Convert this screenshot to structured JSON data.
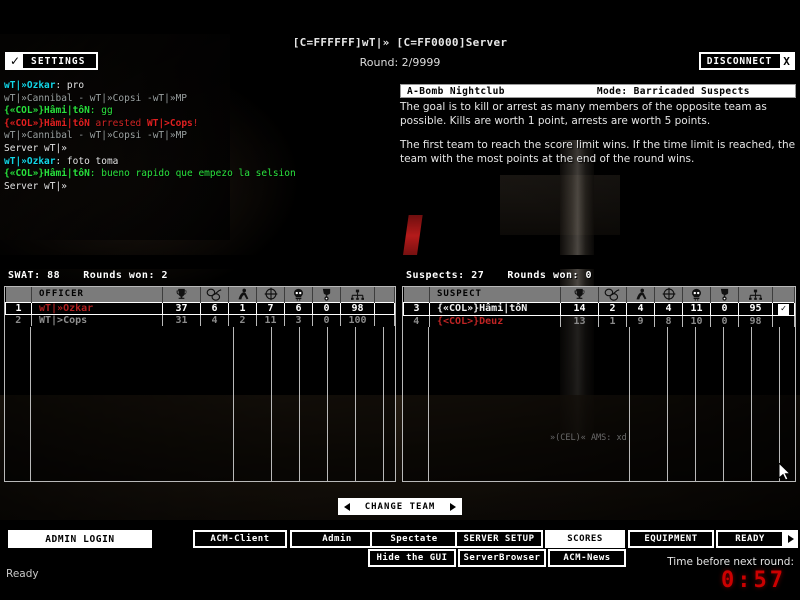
{
  "header": {
    "server_title": "[C=FFFFFF]wT|» [C=FF0000]Server",
    "round_line": "Round: 2/9999",
    "settings_label": "SETTINGS",
    "settings_check": "✓",
    "disconnect_label": "DISCONNECT",
    "disconnect_x": "X"
  },
  "chat": {
    "lines": [
      {
        "segments": [
          {
            "text": "wT|»Ozkar",
            "style": "c-name-c"
          },
          {
            "text": ": pro",
            "style": "c-white"
          }
        ]
      },
      {
        "segments": [
          {
            "text": " wT|»Cannibal - wT|»Copsi -wT|»MP",
            "style": "c-dim"
          }
        ]
      },
      {
        "segments": [
          {
            "text": "{«COL»}Hâmi|tôN",
            "style": "c-green"
          },
          {
            "text": ": gg",
            "style": "c-greenmsg"
          }
        ]
      },
      {
        "segments": [
          {
            "text": "{«COL»}Hâmi|tôN",
            "style": "c-red"
          },
          {
            "text": " arrested ",
            "style": "c-redmsg"
          },
          {
            "text": "WT|>Cops",
            "style": "c-red"
          },
          {
            "text": "!",
            "style": "c-redmsg"
          }
        ]
      },
      {
        "segments": [
          {
            "text": " wT|»Cannibal - wT|»Copsi -wT|»MP",
            "style": "c-dim"
          }
        ]
      },
      {
        "segments": [
          {
            "text": "Server wT|»",
            "style": "c-white"
          }
        ]
      },
      {
        "segments": [
          {
            "text": "wT|»Ozkar",
            "style": "c-name-c"
          },
          {
            "text": ": foto toma",
            "style": "c-white"
          }
        ]
      },
      {
        "segments": [
          {
            "text": "{«COL»}Hâmi|tôN",
            "style": "c-green"
          },
          {
            "text": ": bueno rapido que empezo la selsion",
            "style": "c-greenmsg"
          }
        ]
      },
      {
        "segments": [
          {
            "text": "Server wT|»",
            "style": "c-white"
          }
        ]
      }
    ]
  },
  "briefing": {
    "map": "A-Bomb Nightclub",
    "mode": "Mode: Barricaded Suspects",
    "paragraphs": [
      "The goal is to kill or arrest as many members of the opposite team as possible.  Kills are worth 1 point, arrests are worth 5 points.",
      "The first team to reach the score limit wins.  If the time limit is reached, the team with the most points at the end of the round wins."
    ]
  },
  "scoreboard": {
    "swat": {
      "team_label": "SWAT: 88",
      "rounds_won_label": "Rounds won: 2",
      "name_header": "OFFICER",
      "rows": [
        {
          "num": "1",
          "name": "wT|»Ozkar",
          "name_style": "nm-red",
          "stats": [
            "37",
            "6",
            "1",
            "7",
            "6",
            "0",
            "98"
          ],
          "ready": "",
          "highlight": true
        },
        {
          "num": "2",
          "name": "WT|>Cops",
          "name_style": "nm-grey",
          "stats": [
            "31",
            "4",
            "2",
            "11",
            "3",
            "0",
            "100"
          ],
          "ready": "",
          "highlight": false
        }
      ]
    },
    "suspects": {
      "team_label": "Suspects: 27",
      "rounds_won_label": "Rounds won: 0",
      "name_header": "SUSPECT",
      "rows": [
        {
          "num": "3",
          "name": "{«COL»}Hâmi|tôN",
          "name_style": "nm-white",
          "stats": [
            "14",
            "2",
            "4",
            "4",
            "11",
            "0",
            "95"
          ],
          "ready": "✓",
          "highlight": true
        },
        {
          "num": "4",
          "name": "{<COL>}Deuz",
          "name_style": "nm-red2",
          "stats": [
            "13",
            "1",
            "9",
            "8",
            "10",
            "0",
            "98"
          ],
          "ready": "",
          "highlight": false
        }
      ]
    },
    "stat_icons": [
      "trophy-icon",
      "handcuffs-icon",
      "arrest-icon",
      "crosshair-icon",
      "skull-icon",
      "medal-icon",
      "ping-icon"
    ],
    "ghost_text": "»(CEL)« AMS: xd"
  },
  "change_team": {
    "label": "CHANGE TEAM"
  },
  "bottom": {
    "admin_login": "ADMIN LOGIN",
    "buttons": [
      {
        "label": "ACM-Client",
        "white": false
      },
      {
        "label": "Admin",
        "white": false
      },
      {
        "label": "Spectate",
        "white": false
      },
      {
        "label": "SERVER SETUP",
        "white": false
      },
      {
        "label": "SCORES",
        "white": true
      },
      {
        "label": "EQUIPMENT",
        "white": false
      },
      {
        "label": "READY",
        "white": false
      },
      {
        "label": "Hide the GUI",
        "white": false
      },
      {
        "label": "ServerBrowser",
        "white": false
      },
      {
        "label": "ACM-News",
        "white": false
      }
    ],
    "timer_label": "Time before next round:",
    "timer_value": "0:57",
    "status": "Ready"
  },
  "colors": {
    "accent_red": "#cc0000",
    "chat_cyan": "#12d7e8",
    "chat_green": "#28e03c",
    "header_grey": "#7b7b7b"
  }
}
